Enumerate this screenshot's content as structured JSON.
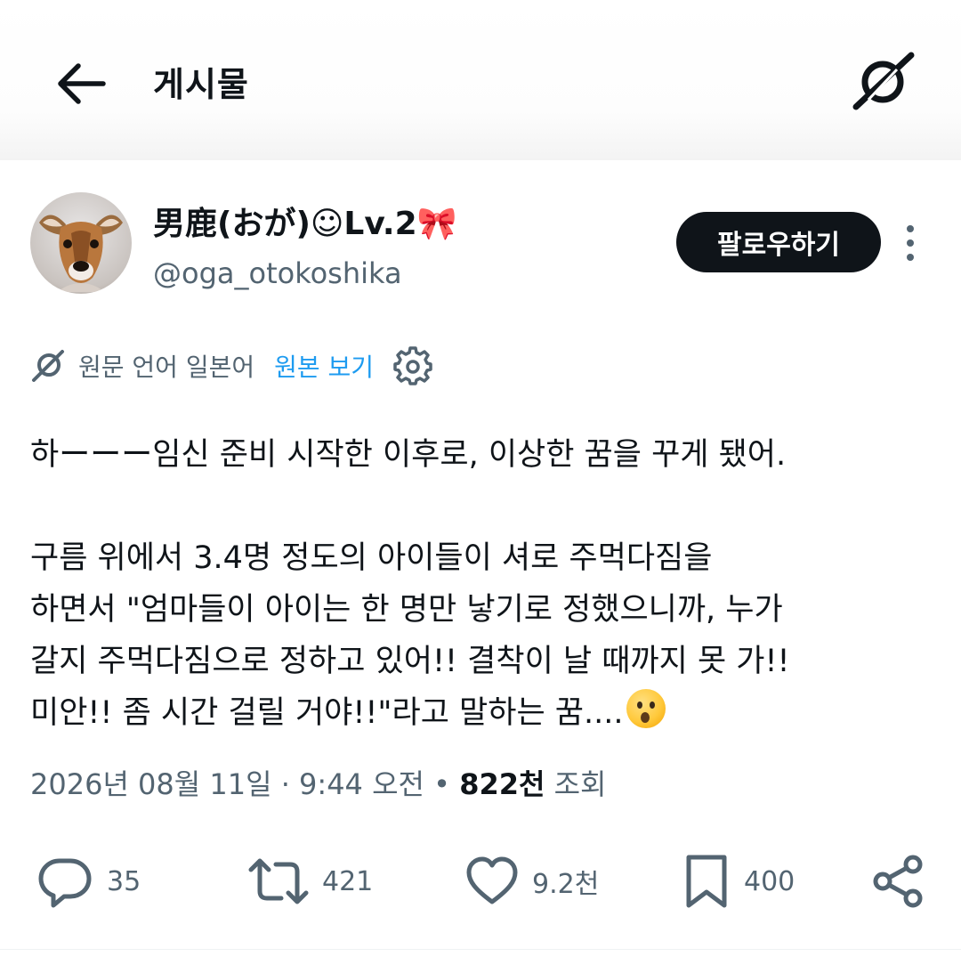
{
  "header": {
    "title": "게시물"
  },
  "author": {
    "display_name": "男鹿(おが)☺Lv.2🎀",
    "handle": "@oga_otokoshika",
    "follow_label": "팔로우하기"
  },
  "translation": {
    "source_language": "원문 언어 일본어",
    "show_original_label": "원본 보기"
  },
  "tweet": {
    "text": "하ーーー임신 준비 시작한 이후로, 이상한 꿈을 꾸게 됐어.\n\n구름 위에서 3.4명 정도의 아이들이 셔로 주먹다짐을\n하면서 \"엄마들이 아이는 한 명만 낳기로 정했으니까, 누가\n갈지 주먹다짐으로 정하고 있어!! 결착이 날 때까지 못 가!!\n미안!! 좀 시간 걸릴 거야!!\"라고 말하는 꿈....",
    "emoji": "hushed-face"
  },
  "meta": {
    "datetime": "2026년 08월 11일 · 9:44 오전",
    "separator": " • ",
    "views_count": "822천",
    "views_label": " 조회"
  },
  "actions": {
    "replies": "35",
    "reposts": "421",
    "likes": "9.2천",
    "bookmarks": "400"
  },
  "colors": {
    "text": "#0f1419",
    "secondary": "#536471",
    "link": "#1d9bf0",
    "button": "#0f1419"
  }
}
